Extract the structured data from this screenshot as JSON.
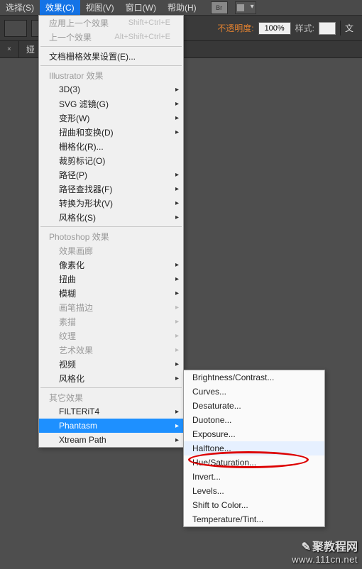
{
  "menubar": {
    "items": [
      "选择(S)",
      "效果(C)",
      "视图(V)",
      "窗口(W)",
      "帮助(H)"
    ],
    "br_label": "Br"
  },
  "toolbar": {
    "opacity_label": "不透明度:",
    "opacity_value": "100%",
    "style_label": "样式:",
    "doc_label": "文"
  },
  "tabs": {
    "tab1": "娅",
    "close": "×"
  },
  "menu": {
    "apply_last": "应用上一个效果",
    "apply_last_sc": "Shift+Ctrl+E",
    "last_effect": "上一个效果",
    "last_effect_sc": "Alt+Shift+Ctrl+E",
    "raster_settings": "文档栅格效果设置(E)...",
    "section_ai": "Illustrator 效果",
    "ai": {
      "3d": "3D(3)",
      "svg": "SVG 滤镜(G)",
      "warp": "变形(W)",
      "distort": "扭曲和变换(D)",
      "rasterize": "栅格化(R)...",
      "cropmarks": "裁剪标记(O)",
      "path": "路径(P)",
      "pathfinder": "路径查找器(F)",
      "convertshape": "转换为形状(V)",
      "stylize": "风格化(S)"
    },
    "section_ps": "Photoshop 效果",
    "ps": {
      "gallery": "效果画廊",
      "pixelate": "像素化",
      "distort": "扭曲",
      "blur": "模糊",
      "brush": "画笔描边",
      "sketch": "素描",
      "texture": "纹理",
      "artistic": "艺术效果",
      "video": "视频",
      "stylize": "风格化"
    },
    "section_other": "其它效果",
    "other": {
      "filterit": "FILTERiT4",
      "phantasm": "Phantasm",
      "xtream": "Xtream Path"
    }
  },
  "submenu": {
    "items": [
      "Brightness/Contrast...",
      "Curves...",
      "Desaturate...",
      "Duotone...",
      "Exposure...",
      "Halftone...",
      "Hue/Saturation...",
      "Invert...",
      "Levels...",
      "Shift to Color...",
      "Temperature/Tint..."
    ],
    "highlight_index": 5
  },
  "watermark": {
    "brand": "聚教程网",
    "url": "www.111cn.net"
  }
}
